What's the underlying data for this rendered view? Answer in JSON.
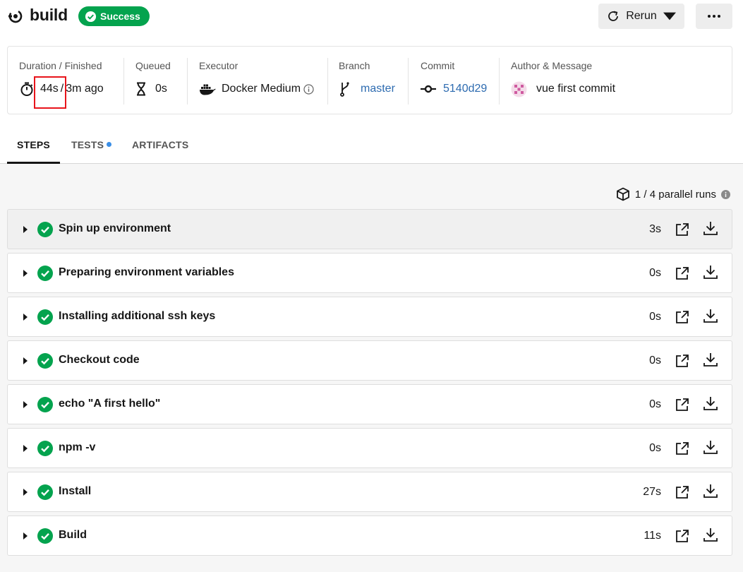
{
  "header": {
    "title": "build",
    "status": "Success",
    "rerun_label": "Rerun"
  },
  "summary": {
    "duration": {
      "label": "Duration / Finished",
      "duration": "44s",
      "sep": "/",
      "finished": "3m ago"
    },
    "queued": {
      "label": "Queued",
      "value": "0s"
    },
    "executor": {
      "label": "Executor",
      "value": "Docker Medium"
    },
    "branch": {
      "label": "Branch",
      "value": "master"
    },
    "commit": {
      "label": "Commit",
      "value": "5140d29"
    },
    "author": {
      "label": "Author & Message",
      "value": "vue first commit"
    }
  },
  "tabs": [
    {
      "label": "STEPS",
      "active": true
    },
    {
      "label": "TESTS",
      "active": false,
      "dot": true
    },
    {
      "label": "ARTIFACTS",
      "active": false
    }
  ],
  "parallel_runs": "1 / 4 parallel runs",
  "steps": [
    {
      "name": "Spin up environment",
      "duration": "3s"
    },
    {
      "name": "Preparing environment variables",
      "duration": "0s"
    },
    {
      "name": "Installing additional ssh keys",
      "duration": "0s"
    },
    {
      "name": "Checkout code",
      "duration": "0s"
    },
    {
      "name": "echo \"A first hello\"",
      "duration": "0s"
    },
    {
      "name": "npm -v",
      "duration": "0s"
    },
    {
      "name": "Install",
      "duration": "27s"
    },
    {
      "name": "Build",
      "duration": "11s"
    }
  ],
  "colors": {
    "success": "#04a34e",
    "link": "#2d6bb0",
    "highlight": "#e8141b",
    "tab_dot": "#3a8ee6"
  }
}
